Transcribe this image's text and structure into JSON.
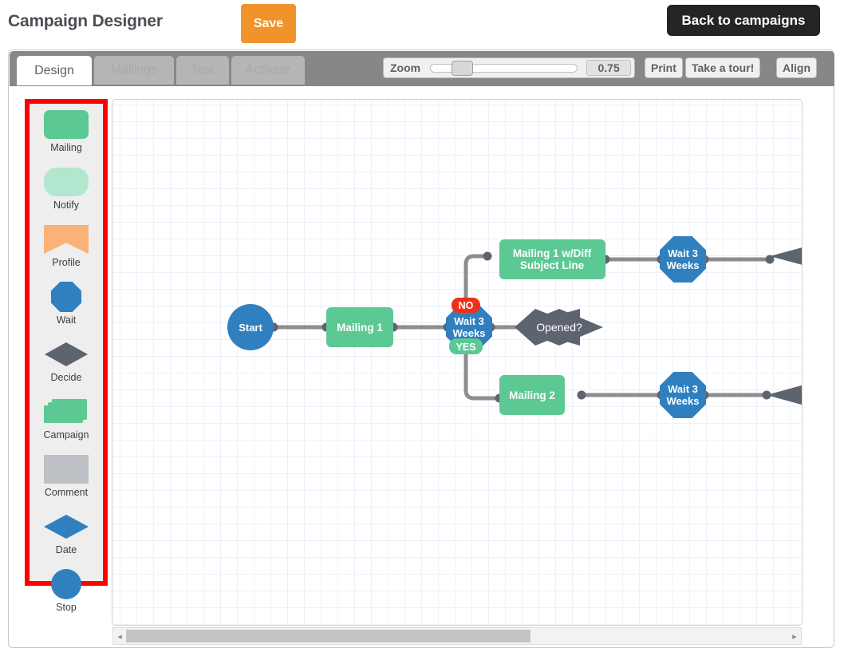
{
  "header": {
    "title": "Campaign Designer",
    "save_label": "Save",
    "back_label": "Back to campaigns"
  },
  "tabs": [
    {
      "label": "Design",
      "active": true
    },
    {
      "label": "Mailings",
      "active": false
    },
    {
      "label": "Test",
      "active": false
    },
    {
      "label": "Activate",
      "active": false
    }
  ],
  "toolbar": {
    "zoom_label": "Zoom",
    "zoom_value": "0.75",
    "print_label": "Print",
    "tour_label": "Take a tour!",
    "align_label": "Align"
  },
  "palette": {
    "items": [
      {
        "label": "Mailing",
        "icon": "rounded-rectangle-icon",
        "color": "#5cc894"
      },
      {
        "label": "Notify",
        "icon": "pill-icon",
        "color": "#b3e6ce"
      },
      {
        "label": "Profile",
        "icon": "bowtie-icon",
        "color": "#fbb276"
      },
      {
        "label": "Wait",
        "icon": "octagon-icon",
        "color": "#3080bf"
      },
      {
        "label": "Decide",
        "icon": "diamond-icon",
        "color": "#5d6470"
      },
      {
        "label": "Campaign",
        "icon": "stacked-cards-icon",
        "color": "#5cc894"
      },
      {
        "label": "Comment",
        "icon": "rectangle-icon",
        "color": "#bdc1c6"
      },
      {
        "label": "Date",
        "icon": "diamond-icon",
        "color": "#3080bf"
      },
      {
        "label": "Stop",
        "icon": "circle-icon",
        "color": "#3080bf"
      }
    ]
  },
  "canvas": {
    "nodes": [
      {
        "id": "start",
        "label": "Start",
        "shape": "circle",
        "color": "#3080bf"
      },
      {
        "id": "mailing1",
        "label": "Mailing 1",
        "shape": "rectangle",
        "color": "#5cc894"
      },
      {
        "id": "wait1",
        "label": "Wait 3 Weeks",
        "shape": "octagon",
        "color": "#3080bf"
      },
      {
        "id": "opened",
        "label": "Opened?",
        "shape": "diamond",
        "color": "#5d6470"
      },
      {
        "id": "mailing1b",
        "label": "Mailing 1 w/Diff Subject Line",
        "shape": "rectangle",
        "color": "#5cc894"
      },
      {
        "id": "wait2",
        "label": "Wait 3 Weeks",
        "shape": "octagon",
        "color": "#3080bf"
      },
      {
        "id": "mailing2",
        "label": "Mailing 2",
        "shape": "rectangle",
        "color": "#5cc894"
      },
      {
        "id": "wait3",
        "label": "Wait 3 Weeks",
        "shape": "octagon",
        "color": "#3080bf"
      }
    ],
    "branch_labels": {
      "no": "NO",
      "yes": "YES",
      "no_color": "#f0301a",
      "yes_color": "#5cc894"
    }
  },
  "scrollbar": {
    "left_arrow": "◂",
    "right_arrow": "▸"
  }
}
